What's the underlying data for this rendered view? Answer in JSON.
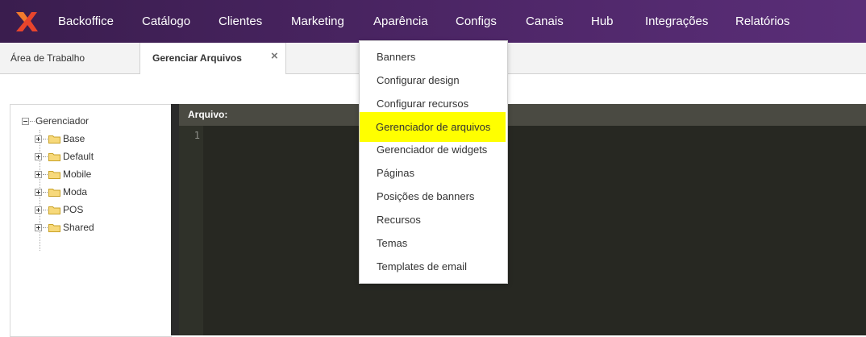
{
  "nav": {
    "items": [
      {
        "label": "Backoffice"
      },
      {
        "label": "Catálogo"
      },
      {
        "label": "Clientes"
      },
      {
        "label": "Marketing"
      },
      {
        "label": "Aparência"
      },
      {
        "label": "Configs"
      },
      {
        "label": "Canais"
      },
      {
        "label": "Hub"
      },
      {
        "label": "Integrações"
      },
      {
        "label": "Relatórios"
      }
    ],
    "bg_color": "#4f2769",
    "logo_color": "#e8452c"
  },
  "tabs": [
    {
      "label": "Área de Trabalho"
    },
    {
      "label": "Gerenciar Arquivos",
      "close": "×"
    }
  ],
  "tree": {
    "root": "Gerenciador",
    "items": [
      {
        "label": "Base"
      },
      {
        "label": "Default"
      },
      {
        "label": "Mobile"
      },
      {
        "label": "Moda"
      },
      {
        "label": "POS"
      },
      {
        "label": "Shared"
      }
    ],
    "folder_color": "#f3c74b"
  },
  "editor": {
    "header_label": "Arquivo:",
    "line_numbers": [
      "1"
    ],
    "bg_color": "#272822"
  },
  "dropdown": {
    "items": [
      {
        "label": "Banners"
      },
      {
        "label": "Configurar design"
      },
      {
        "label": "Configurar recursos"
      },
      {
        "label": "Gerenciador de arquivos",
        "highlighted": true
      },
      {
        "label": "Gerenciador de widgets"
      },
      {
        "label": "Páginas"
      },
      {
        "label": "Posições de banners"
      },
      {
        "label": "Recursos"
      },
      {
        "label": "Temas"
      },
      {
        "label": "Templates de email"
      }
    ],
    "highlight_color": "#ffff00"
  }
}
